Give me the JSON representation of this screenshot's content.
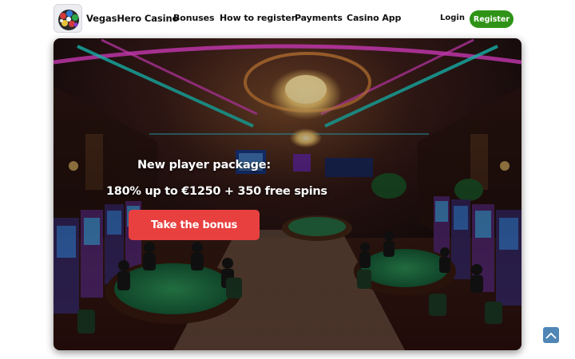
{
  "header": {
    "brand": "VegasHero Casino",
    "logo_icon": "casino-chips-logo",
    "nav": [
      "Bonuses",
      "How to register",
      "Payments",
      "Casino App"
    ],
    "login_label": "Login",
    "register_label": "Register"
  },
  "hero": {
    "title": "New player package:",
    "offer": "180% up to €1250 + 350 free spins",
    "cta_label": "Take the bonus",
    "background": "casino-interior-image"
  },
  "scroll_top": {
    "icon": "chevron-up-icon"
  },
  "colors": {
    "register_button": "#2f9317",
    "cta_button": "#e8403f",
    "scroll_top": "#4f86b5"
  }
}
